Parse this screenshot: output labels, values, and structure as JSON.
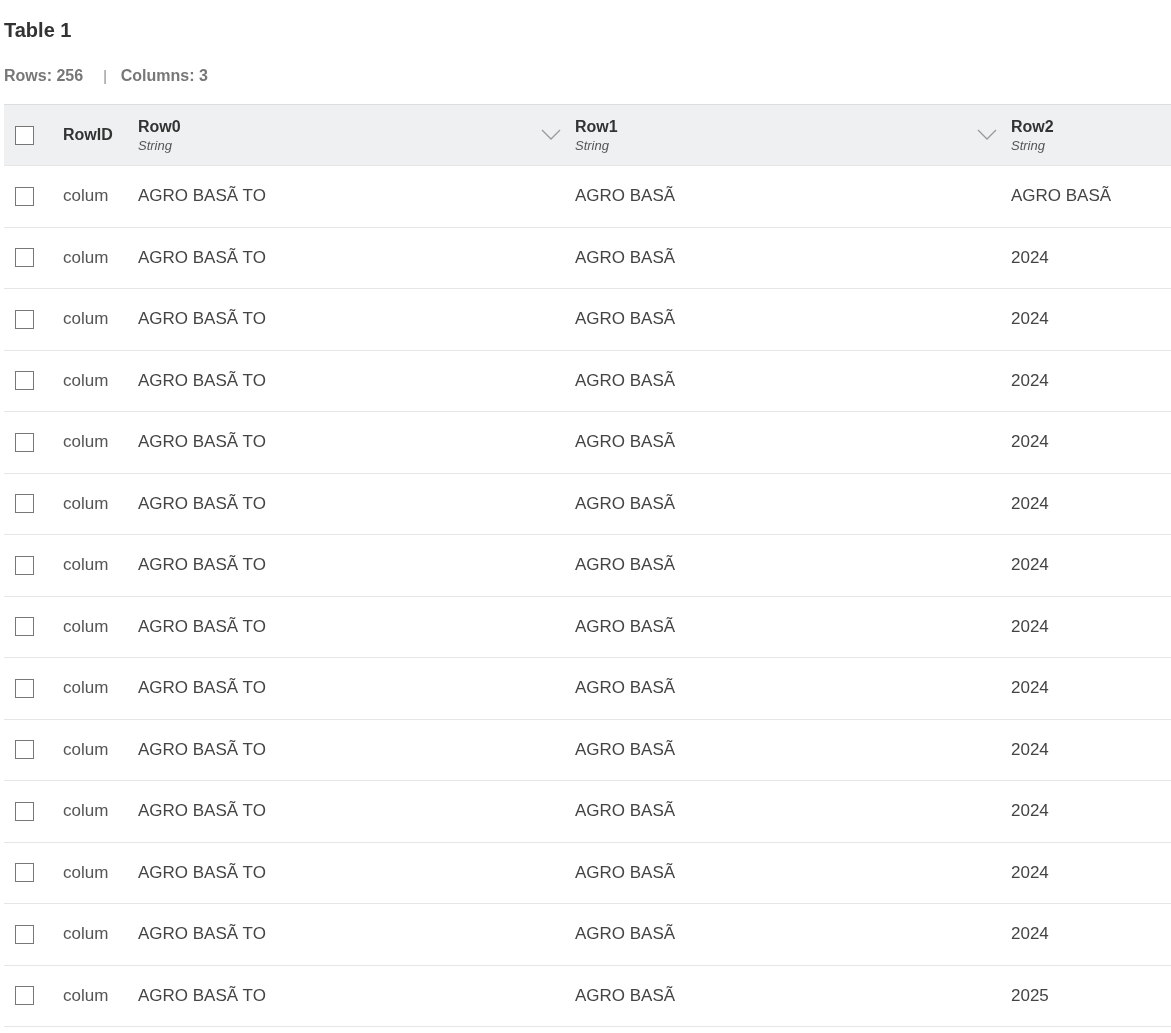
{
  "title": "Table 1",
  "stats": {
    "rows": "Rows: 256",
    "separator": "|",
    "columns": "Columns: 3"
  },
  "table": {
    "select_all": {
      "checked": false
    },
    "columns": [
      {
        "label": "RowID",
        "kind": "id"
      },
      {
        "label": "Row0",
        "type": "String",
        "kind": "data",
        "menu": true
      },
      {
        "label": "Row1",
        "type": "String",
        "kind": "data",
        "menu": true
      },
      {
        "label": "Row2",
        "type": "String",
        "kind": "data",
        "menu": false
      }
    ],
    "rows": [
      {
        "checked": false,
        "cells": [
          "colum",
          "AGRO BASÃ TO",
          "AGRO BASÃ",
          "AGRO BASÃ"
        ]
      },
      {
        "checked": false,
        "cells": [
          "colum",
          "AGRO BASÃ TO",
          "AGRO BASÃ",
          "2024"
        ]
      },
      {
        "checked": false,
        "cells": [
          "colum",
          "AGRO BASÃ TO",
          "AGRO BASÃ",
          "2024"
        ]
      },
      {
        "checked": false,
        "cells": [
          "colum",
          "AGRO BASÃ TO",
          "AGRO BASÃ",
          "2024"
        ]
      },
      {
        "checked": false,
        "cells": [
          "colum",
          "AGRO BASÃ TO",
          "AGRO BASÃ",
          "2024"
        ]
      },
      {
        "checked": false,
        "cells": [
          "colum",
          "AGRO BASÃ TO",
          "AGRO BASÃ",
          "2024"
        ]
      },
      {
        "checked": false,
        "cells": [
          "colum",
          "AGRO BASÃ TO",
          "AGRO BASÃ",
          "2024"
        ]
      },
      {
        "checked": false,
        "cells": [
          "colum",
          "AGRO BASÃ TO",
          "AGRO BASÃ",
          "2024"
        ]
      },
      {
        "checked": false,
        "cells": [
          "colum",
          "AGRO BASÃ TO",
          "AGRO BASÃ",
          "2024"
        ]
      },
      {
        "checked": false,
        "cells": [
          "colum",
          "AGRO BASÃ TO",
          "AGRO BASÃ",
          "2024"
        ]
      },
      {
        "checked": false,
        "cells": [
          "colum",
          "AGRO BASÃ TO",
          "AGRO BASÃ",
          "2024"
        ]
      },
      {
        "checked": false,
        "cells": [
          "colum",
          "AGRO BASÃ TO",
          "AGRO BASÃ",
          "2024"
        ]
      },
      {
        "checked": false,
        "cells": [
          "colum",
          "AGRO BASÃ TO",
          "AGRO BASÃ",
          "2024"
        ]
      },
      {
        "checked": false,
        "cells": [
          "colum",
          "AGRO BASÃ TO",
          "AGRO BASÃ",
          "2025"
        ]
      }
    ]
  }
}
